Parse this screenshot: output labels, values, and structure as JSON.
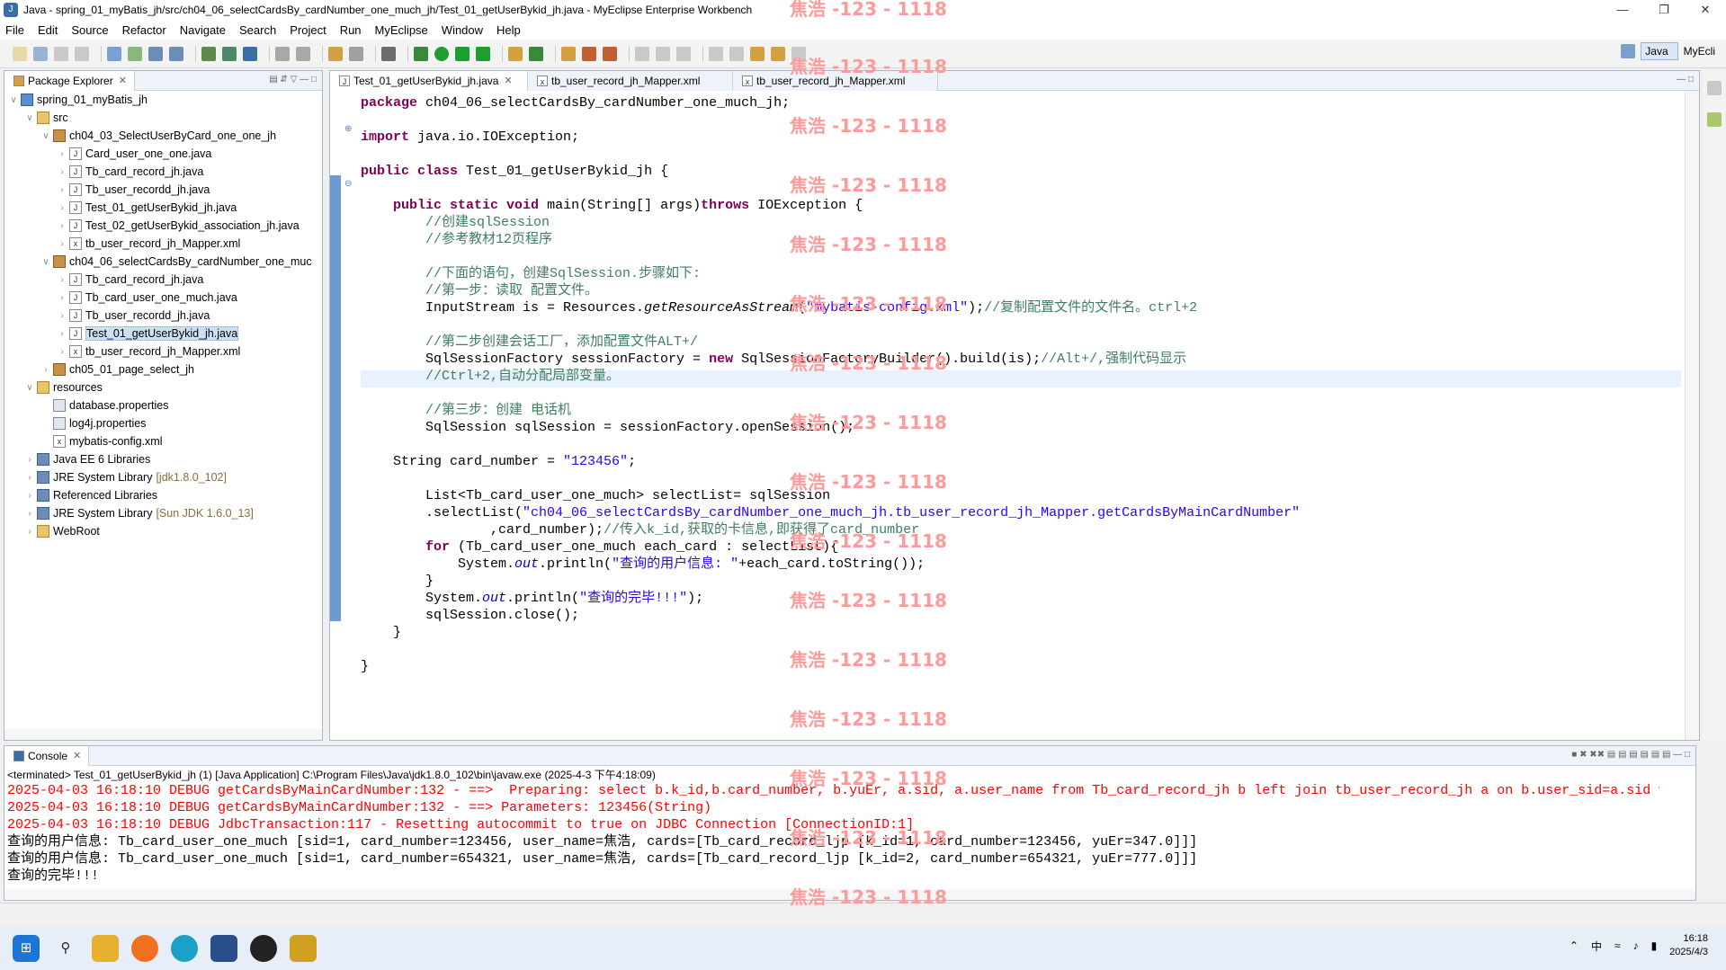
{
  "window": {
    "title": "Java - spring_01_myBatis_jh/src/ch04_06_selectCardsBy_cardNumber_one_much_jh/Test_01_getUserBykid_jh.java - MyEclipse Enterprise Workbench"
  },
  "menu": [
    "File",
    "Edit",
    "Source",
    "Refactor",
    "Navigate",
    "Search",
    "Project",
    "Run",
    "MyEclipse",
    "Window",
    "Help"
  ],
  "perspectives": {
    "java": "Java",
    "myeclipse": "MyEcli"
  },
  "explorer": {
    "title": "Package Explorer",
    "items": [
      {
        "label": "spring_01_myBatis_jh",
        "level": 0,
        "icon": "proj",
        "open": true
      },
      {
        "label": "src",
        "level": 1,
        "icon": "folder",
        "open": true
      },
      {
        "label": "ch04_03_SelectUserByCard_one_one_jh",
        "level": 2,
        "icon": "pkg",
        "open": true
      },
      {
        "label": "Card_user_one_one.java",
        "level": 3,
        "icon": "java"
      },
      {
        "label": "Tb_card_record_jh.java",
        "level": 3,
        "icon": "java"
      },
      {
        "label": "Tb_user_recordd_jh.java",
        "level": 3,
        "icon": "java"
      },
      {
        "label": "Test_01_getUserBykid_jh.java",
        "level": 3,
        "icon": "java"
      },
      {
        "label": "Test_02_getUserBykid_association_jh.java",
        "level": 3,
        "icon": "java"
      },
      {
        "label": "tb_user_record_jh_Mapper.xml",
        "level": 3,
        "icon": "xml"
      },
      {
        "label": "ch04_06_selectCardsBy_cardNumber_one_muc",
        "level": 2,
        "icon": "pkg",
        "open": true
      },
      {
        "label": "Tb_card_record_jh.java",
        "level": 3,
        "icon": "java"
      },
      {
        "label": "Tb_card_user_one_much.java",
        "level": 3,
        "icon": "java"
      },
      {
        "label": "Tb_user_recordd_jh.java",
        "level": 3,
        "icon": "java"
      },
      {
        "label": "Test_01_getUserBykid_jh.java",
        "level": 3,
        "icon": "java",
        "selected": true
      },
      {
        "label": "tb_user_record_jh_Mapper.xml",
        "level": 3,
        "icon": "xml"
      },
      {
        "label": "ch05_01_page_select_jh",
        "level": 2,
        "icon": "pkg"
      },
      {
        "label": "resources",
        "level": 1,
        "icon": "folder",
        "open": true
      },
      {
        "label": "database.properties",
        "level": 2,
        "icon": "props"
      },
      {
        "label": "log4j.properties",
        "level": 2,
        "icon": "props"
      },
      {
        "label": "mybatis-config.xml",
        "level": 2,
        "icon": "xml"
      },
      {
        "label": "Java EE 6 Libraries",
        "level": 1,
        "icon": "lib"
      },
      {
        "label": "JRE System Library",
        "level": 1,
        "icon": "lib",
        "decor": "[jdk1.8.0_102]"
      },
      {
        "label": "Referenced Libraries",
        "level": 1,
        "icon": "lib"
      },
      {
        "label": "JRE System Library",
        "level": 1,
        "icon": "lib",
        "decor": "[Sun JDK 1.6.0_13]"
      },
      {
        "label": "WebRoot",
        "level": 1,
        "icon": "folder"
      }
    ]
  },
  "editor": {
    "tabs": [
      "Test_01_getUserBykid_jh.java",
      "tb_user_record_jh_Mapper.xml",
      "tb_user_record_jh_Mapper.xml"
    ],
    "lines": [
      {
        "n": 0,
        "parts": [
          [
            "kw",
            "package"
          ],
          [
            "",
            "ch04_06_selectCardsBy_cardNumber_one_much_jh;"
          ]
        ]
      },
      {
        "n": 2,
        "parts": [
          [
            "kw",
            "import"
          ],
          [
            "",
            "java.io.IOException;"
          ]
        ]
      },
      {
        "n": 4,
        "parts": [
          [
            "kw",
            "public"
          ],
          [
            "kw",
            "class"
          ],
          [
            "",
            "Test_01_getUserBykid_jh {"
          ]
        ]
      },
      {
        "n": 6,
        "parts": [
          [
            "",
            "    "
          ],
          [
            "kw",
            "public"
          ],
          [
            "kw",
            "static"
          ],
          [
            "kw",
            "void"
          ],
          [
            "",
            "main(String[] args)"
          ],
          [
            "kw",
            "throws"
          ],
          [
            "",
            "IOException {"
          ]
        ]
      },
      {
        "n": 7,
        "parts": [
          [
            "cm",
            "        //创建sqlSession"
          ]
        ]
      },
      {
        "n": 8,
        "parts": [
          [
            "cm",
            "        //参考教材12页程序"
          ]
        ]
      },
      {
        "n": 10,
        "parts": [
          [
            "cm",
            "        //下面的语句，创建SqlSession.步骤如下:"
          ]
        ]
      },
      {
        "n": 11,
        "parts": [
          [
            "cm",
            "        //第一步：读取 配置文件。"
          ]
        ]
      },
      {
        "n": 12,
        "parts": [
          [
            "",
            "        InputStream is = Resources."
          ],
          [
            "it",
            "getResourceAsStream"
          ],
          [
            "",
            "("
          ],
          [
            "str",
            "\"mybatis-config.xml\""
          ],
          [
            "",
            ");"
          ],
          [
            "cm",
            "//复制配置文件的文件名。ctrl+2"
          ]
        ]
      },
      {
        "n": 14,
        "parts": [
          [
            "cm",
            "        //第二步创建会话工厂，添加配置文件ALT+/"
          ]
        ]
      },
      {
        "n": 15,
        "parts": [
          [
            "",
            "        SqlSessionFactory sessionFactory = "
          ],
          [
            "kw",
            "new"
          ],
          [
            "",
            "SqlSessionFactoryBuilder().build(is);"
          ],
          [
            "cm",
            "//Alt+/,强制代码显示"
          ]
        ]
      },
      {
        "n": 16,
        "parts": [
          [
            "cm",
            "        //Ctrl+2,自动分配局部变量。"
          ]
        ]
      },
      {
        "n": 18,
        "parts": [
          [
            "cm",
            "        //第三步：创建 电话机"
          ]
        ]
      },
      {
        "n": 19,
        "parts": [
          [
            "",
            "        SqlSession sqlSession = sessionFactory.openSession();"
          ]
        ]
      },
      {
        "n": 21,
        "parts": [
          [
            "",
            "    String card_number = "
          ],
          [
            "str",
            "\"123456\""
          ],
          [
            "",
            ";"
          ]
        ]
      },
      {
        "n": 23,
        "parts": [
          [
            "",
            "        List<Tb_card_user_one_much> selectList= sqlSession"
          ]
        ]
      },
      {
        "n": 24,
        "parts": [
          [
            "",
            "        .selectList("
          ],
          [
            "str",
            "\"ch04_06_selectCardsBy_cardNumber_one_much_jh.tb_user_record_jh_Mapper.getCardsByMainCardNumber\""
          ]
        ]
      },
      {
        "n": 25,
        "parts": [
          [
            "",
            "                ,card_number);"
          ],
          [
            "cm",
            "//传入k_id,获取的卡信息,即获得了card_number"
          ]
        ]
      },
      {
        "n": 26,
        "parts": [
          [
            "",
            "        "
          ],
          [
            "kw",
            "for"
          ],
          [
            "",
            "(Tb_card_user_one_much each_card : selectList){"
          ]
        ]
      },
      {
        "n": 27,
        "parts": [
          [
            "",
            "            System."
          ],
          [
            "fld",
            "out"
          ],
          [
            "",
            ".println("
          ],
          [
            "str",
            "\"查询的用户信息: \""
          ],
          [
            "",
            "+each_card.toString());"
          ]
        ]
      },
      {
        "n": 28,
        "parts": [
          [
            "",
            "        }"
          ]
        ]
      },
      {
        "n": 29,
        "parts": [
          [
            "",
            "        System."
          ],
          [
            "fld",
            "out"
          ],
          [
            "",
            ".println("
          ],
          [
            "str",
            "\"查询的完毕!!!\""
          ],
          [
            "",
            ");"
          ]
        ]
      },
      {
        "n": 30,
        "parts": [
          [
            "",
            "        sqlSession.close();"
          ]
        ]
      },
      {
        "n": 31,
        "parts": [
          [
            "",
            "    }"
          ]
        ]
      },
      {
        "n": 33,
        "parts": [
          [
            "",
            "}"
          ]
        ]
      }
    ]
  },
  "console": {
    "title": "Console",
    "status": "<terminated> Test_01_getUserBykid_jh (1) [Java Application] C:\\Program Files\\Java\\jdk1.8.0_102\\bin\\javaw.exe (2025-4-3 下午4:18:09)",
    "lines": [
      {
        "red": true,
        "text": "2025-04-03 16:18:10 DEBUG getCardsByMainCardNumber:132 - ==>  Preparing: select b.k_id,b.card_number, b.yuEr, a.sid, a.user_name from Tb_card_record_jh b left join tb_user_record_jh a on b.user_sid=a.sid whe"
      },
      {
        "red": true,
        "text": "2025-04-03 16:18:10 DEBUG getCardsByMainCardNumber:132 - ==> Parameters: 123456(String)"
      },
      {
        "red": true,
        "text": "2025-04-03 16:18:10 DEBUG JdbcTransaction:117 - Resetting autocommit to true on JDBC Connection [ConnectionID:1]"
      },
      {
        "red": false,
        "text": "查询的用户信息: Tb_card_user_one_much [sid=1, card_number=123456, user_name=焦浩, cards=[Tb_card_record_ljp [k_id=1, card_number=123456, yuEr=347.0]]]"
      },
      {
        "red": false,
        "text": "查询的用户信息: Tb_card_user_one_much [sid=1, card_number=654321, user_name=焦浩, cards=[Tb_card_record_ljp [k_id=2, card_number=654321, yuEr=777.0]]]"
      },
      {
        "red": false,
        "text": "查询的完毕!!!"
      }
    ]
  },
  "watermark": "焦浩 -123 - 1118",
  "taskbar": {
    "time": "16:18",
    "date": "2025/4/3",
    "ime": "中"
  }
}
